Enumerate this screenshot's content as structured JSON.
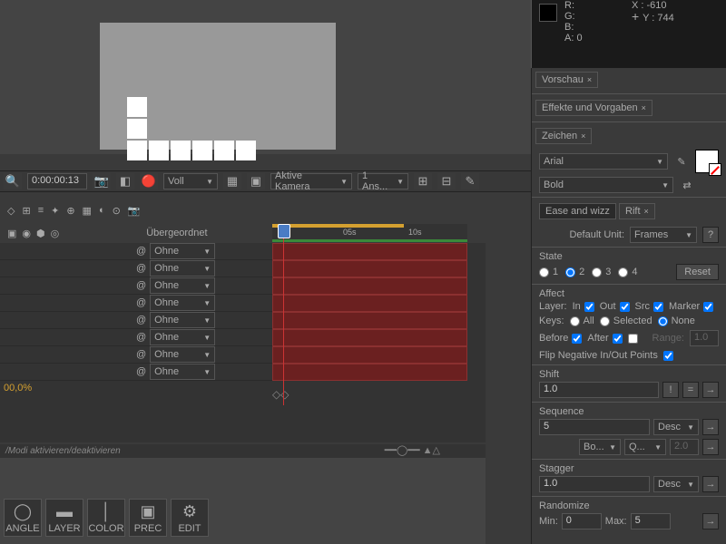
{
  "info": {
    "r": "R:",
    "g": "G:",
    "b": "B:",
    "a": "A:  0",
    "x": "X : -610",
    "y": "Y : 744"
  },
  "ctrl": {
    "time": "0:00:00:13",
    "res": "Voll",
    "camera": "Aktive Kamera",
    "views": "1 Ans..."
  },
  "rightPanels": {
    "vorschau": "Vorschau",
    "effekte": "Effekte und Vorgaben",
    "zeichen": "Zeichen"
  },
  "font": {
    "family": "Arial",
    "weight": "Bold"
  },
  "tabs": {
    "ease": "Ease and wizz",
    "rift": "Rift"
  },
  "rift": {
    "defaultUnit": "Default Unit:",
    "unitVal": "Frames",
    "q": "?",
    "state": "State",
    "s1": "1",
    "s2": "2",
    "s3": "3",
    "s4": "4",
    "reset": "Reset",
    "affect": "Affect",
    "layer": "Layer:",
    "in": "In",
    "out": "Out",
    "src": "Src",
    "marker": "Marker",
    "keys": "Keys:",
    "all": "All",
    "selected": "Selected",
    "none": "None",
    "before": "Before",
    "after": "After",
    "range": "Range:",
    "rangeVal": "1.0",
    "flip": "Flip Negative In/Out Points",
    "shift": "Shift",
    "shiftVal": "1.0",
    "sequence": "Sequence",
    "seqVal": "5",
    "desc": "Desc",
    "bo": "Bo...",
    "qb": "Q...",
    "seqNum": "2.0",
    "stagger": "Stagger",
    "stagVal": "1.0",
    "randomize": "Randomize",
    "min": "Min:",
    "minVal": "0",
    "max": "Max:",
    "maxVal": "5"
  },
  "tl": {
    "parent": "Übergeordnet",
    "none": "Ohne",
    "t5": "05s",
    "t10": "10s",
    "pct": "00,0%",
    "modi": "/Modi aktivieren/deaktivieren"
  },
  "tools": {
    "angle": "ANGLE",
    "layer": "LAYER",
    "color": "COLOR",
    "prec": "PREC",
    "edit": "EDIT"
  },
  "arrow": "▼",
  "arrowr": "▸",
  "x": "×",
  "bang": "!",
  "eq": "=",
  "go": "→"
}
